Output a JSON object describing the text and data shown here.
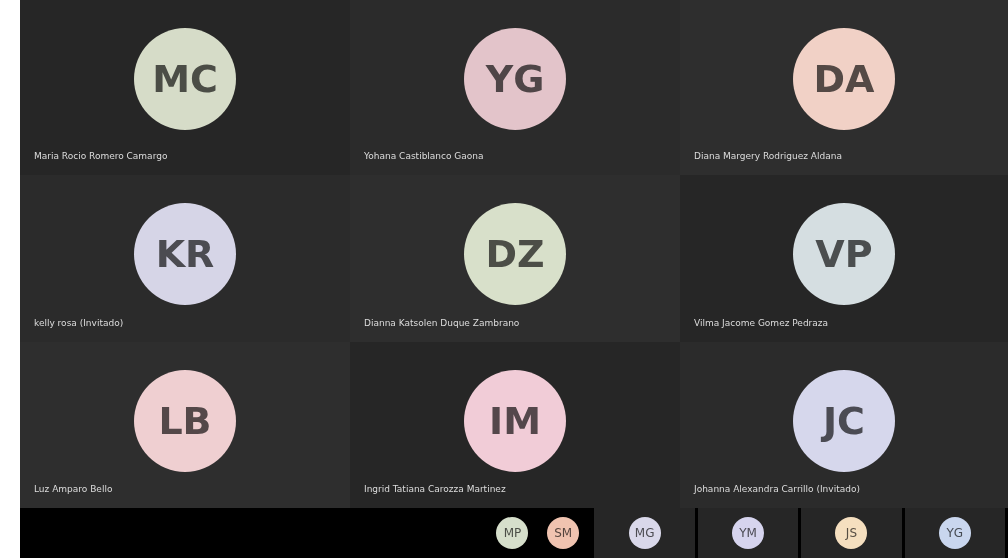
{
  "tiles": [
    {
      "initials": "MC",
      "name": "Maria Rocio Romero Camargo",
      "color": "#d6dcc8"
    },
    {
      "initials": "YG",
      "name": "Yohana Castiblanco Gaona",
      "color": "#e3c4ca"
    },
    {
      "initials": "DA",
      "name": "Diana Margery Rodriguez Aldana",
      "color": "#f1d1c6"
    },
    {
      "initials": "KR",
      "name": "kelly rosa (Invitado)",
      "color": "#d6d5e7"
    },
    {
      "initials": "DZ",
      "name": "Dianna Katsolen Duque Zambrano",
      "color": "#d8e0ca"
    },
    {
      "initials": "VP",
      "name": "Vilma Jacome Gomez Pedraza",
      "color": "#d5dee1"
    },
    {
      "initials": "LB",
      "name": "Luz Amparo Bello",
      "color": "#efcfd1"
    },
    {
      "initials": "IM",
      "name": "Ingrid Tatiana Carozza Martinez",
      "color": "#f1ccd7"
    },
    {
      "initials": "JC",
      "name": "Johanna Alexandra Carrillo (Invitado)",
      "color": "#d6d7ec"
    }
  ],
  "strip": [
    {
      "initials": "MP",
      "color": "#d6dfcb",
      "kind": "plain"
    },
    {
      "initials": "SM",
      "color": "#f0c3b0",
      "kind": "plain"
    },
    {
      "initials": "MG",
      "color": "#d9d8ea",
      "kind": "tile"
    },
    {
      "initials": "YM",
      "color": "#d6d4ee",
      "kind": "tile"
    },
    {
      "initials": "JS",
      "color": "#f5dfbf",
      "kind": "tile"
    },
    {
      "initials": "YG",
      "color": "#c9d6ee",
      "kind": "tile"
    }
  ]
}
